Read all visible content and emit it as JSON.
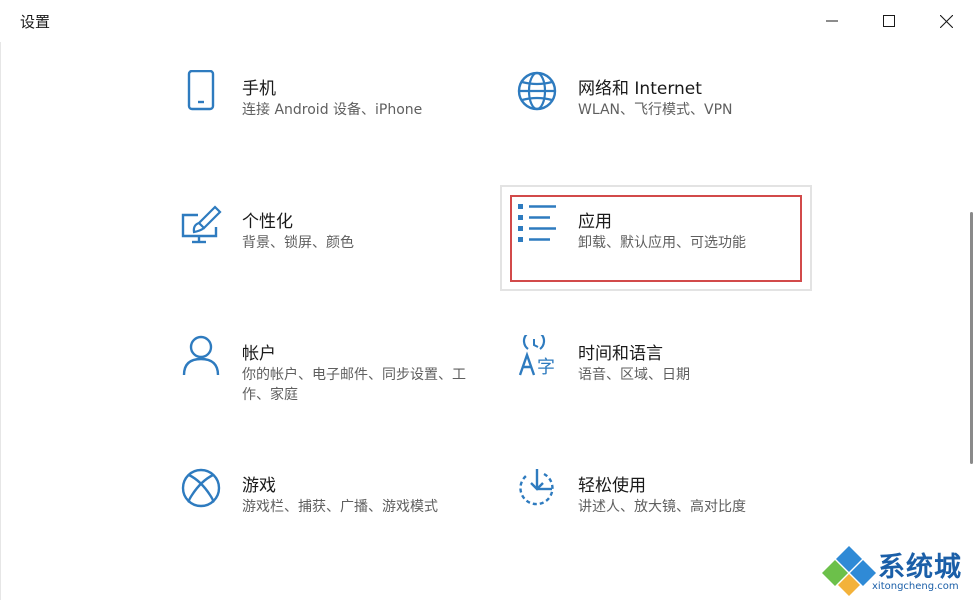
{
  "window": {
    "title": "设置"
  },
  "tiles": [
    {
      "id": "phone",
      "name": "手机",
      "desc": "连接 Android 设备、iPhone",
      "icon": "phone-icon"
    },
    {
      "id": "network",
      "name": "网络和 Internet",
      "desc": "WLAN、飞行模式、VPN",
      "icon": "globe-icon"
    },
    {
      "id": "personalization",
      "name": "个性化",
      "desc": "背景、锁屏、颜色",
      "icon": "paint-monitor-icon"
    },
    {
      "id": "apps",
      "name": "应用",
      "desc": "卸载、默认应用、可选功能",
      "icon": "apps-list-icon"
    },
    {
      "id": "accounts",
      "name": "帐户",
      "desc": "你的帐户、电子邮件、同步设置、工作、家庭",
      "icon": "person-icon"
    },
    {
      "id": "time-language",
      "name": "时间和语言",
      "desc": "语音、区域、日期",
      "icon": "time-language-icon"
    },
    {
      "id": "gaming",
      "name": "游戏",
      "desc": "游戏栏、捕获、广播、游戏模式",
      "icon": "xbox-icon"
    },
    {
      "id": "ease-of-access",
      "name": "轻松使用",
      "desc": "讲述人、放大镜、高对比度",
      "icon": "ease-of-access-icon"
    }
  ],
  "colors": {
    "accent": "#2e7bbf",
    "highlight": "#d24a4a"
  },
  "watermark": {
    "text": "系统城",
    "url": "xitongcheng.com"
  }
}
